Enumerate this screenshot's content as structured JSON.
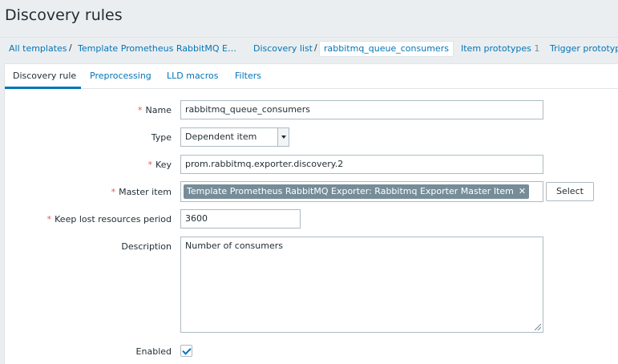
{
  "page": {
    "title": "Discovery rules"
  },
  "breadcrumb": {
    "all_templates": "All templates",
    "template": "Template Prometheus RabbitMQ E…",
    "discovery_list": "Discovery list",
    "current": "rabbitmq_queue_consumers",
    "item_prototypes": "Item prototypes",
    "item_prototypes_count": "1",
    "trigger_prototypes": "Trigger prototypes"
  },
  "tabs": [
    "Discovery rule",
    "Preprocessing",
    "LLD macros",
    "Filters"
  ],
  "form": {
    "name": {
      "label": "Name",
      "value": "rabbitmq_queue_consumers",
      "required": true
    },
    "type": {
      "label": "Type",
      "value": "Dependent item"
    },
    "key": {
      "label": "Key",
      "value": "prom.rabbitmq.exporter.discovery.2",
      "required": true
    },
    "master_item": {
      "label": "Master item",
      "value": "Template Prometheus RabbitMQ Exporter: Rabbitmq Exporter Master Item",
      "remove": "✕",
      "select_label": "Select",
      "required": true
    },
    "keep_lost": {
      "label": "Keep lost resources period",
      "value": "3600",
      "required": true
    },
    "description": {
      "label": "Description",
      "value": "Number of consumers"
    },
    "enabled": {
      "label": "Enabled",
      "checked": true
    }
  },
  "colors": {
    "link": "#0275b8",
    "required": "#e45959",
    "chip": "#768d99",
    "background": "#ebeef0"
  }
}
